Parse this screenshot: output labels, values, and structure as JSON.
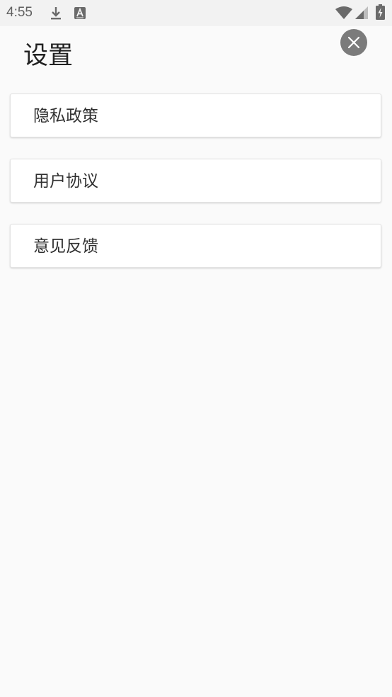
{
  "status_bar": {
    "time": "4:55",
    "icons": [
      "download-icon",
      "keyboard-a-icon",
      "wifi-icon",
      "signal-icon",
      "battery-charging-icon"
    ]
  },
  "header": {
    "title": "设置",
    "close_icon": "close-icon"
  },
  "menu": {
    "items": [
      {
        "label": "隐私政策"
      },
      {
        "label": "用户协议"
      },
      {
        "label": "意见反馈"
      }
    ]
  },
  "colors": {
    "background": "#fafafa",
    "status_bar": "#f2f2f2",
    "close_button": "#7b7b7b",
    "card": "#ffffff",
    "text": "#303030"
  }
}
